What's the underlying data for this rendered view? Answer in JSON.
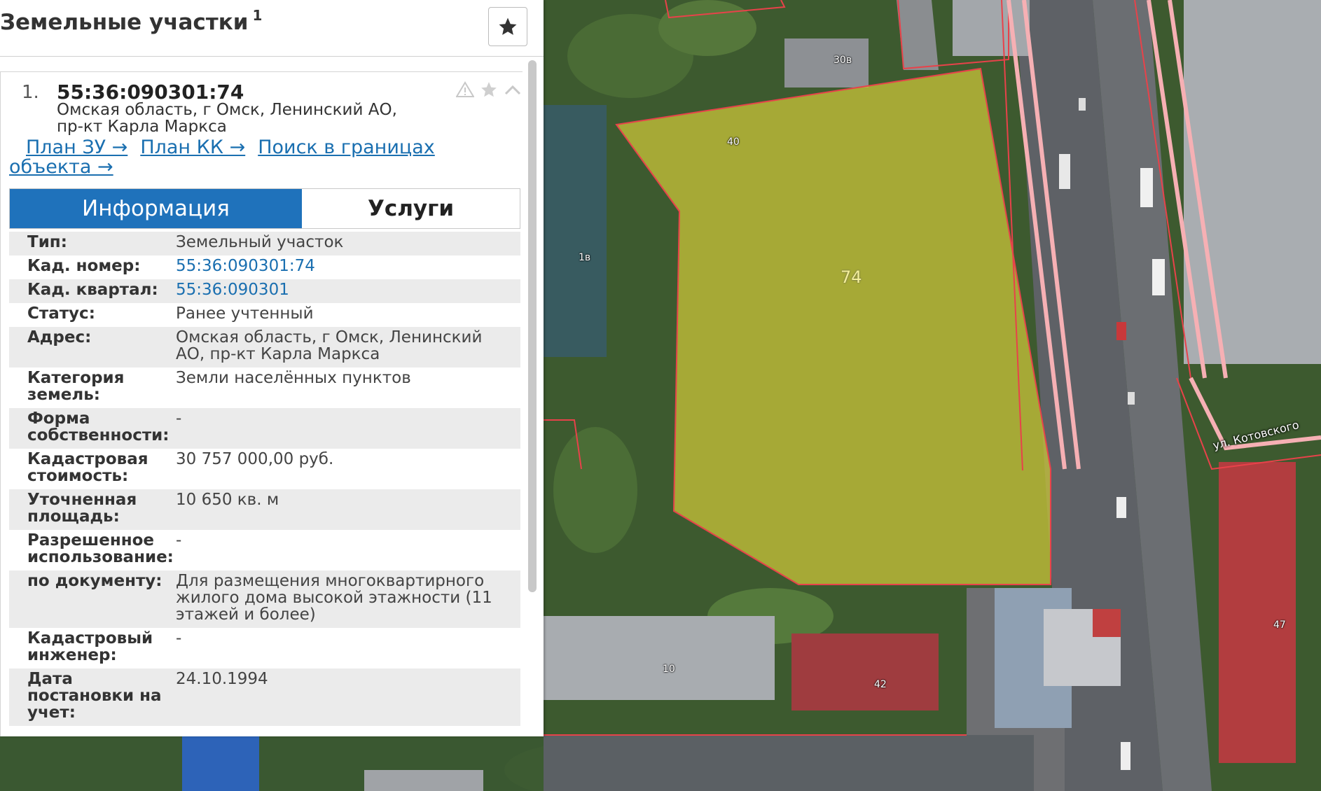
{
  "panel": {
    "title": "Земельные участки",
    "count": "1"
  },
  "card": {
    "index": "1.",
    "cad_number": "55:36:090301:74",
    "address": "Омская область, г Омск, Ленинский АО, пр-кт Карла Маркса",
    "icons": [
      "warning-icon",
      "star-icon",
      "chevron-up-icon"
    ],
    "links": {
      "plan_zu": "План ЗУ →",
      "plan_kk": "План КК →",
      "search": "Поиск в границах объекта →"
    },
    "tabs": {
      "info": "Информация",
      "services": "Услуги"
    },
    "rows": [
      {
        "label": "Тип:",
        "value": "Земельный участок"
      },
      {
        "label": "Кад. номер:",
        "value": "55:36:090301:74",
        "link": true
      },
      {
        "label": "Кад. квартал:",
        "value": "55:36:090301",
        "link": true
      },
      {
        "label": "Статус:",
        "value": "Ранее учтенный"
      },
      {
        "label": "Адрес:",
        "value": "Омская область, г Омск, Ленинский АО, пр-кт Карла Маркса"
      },
      {
        "label": "Категория земель:",
        "value": "Земли населённых пунктов"
      },
      {
        "label": "Форма собственности:",
        "value": "-"
      },
      {
        "label": "Кадастровая стоимость:",
        "value": "30 757 000,00 руб."
      },
      {
        "label": "Уточненная площадь:",
        "value": "10 650 кв. м"
      },
      {
        "label": "Разрешенное использование:",
        "value": "-"
      },
      {
        "label": "по документу:",
        "value": "Для размещения многоквартирного жилого дома высокой этажности (11 этажей и более)"
      },
      {
        "label": "Кадастровый инженер:",
        "value": "-"
      },
      {
        "label": "Дата постановки на учет:",
        "value": "24.10.1994"
      }
    ]
  },
  "map": {
    "parcel_label": "74",
    "street_label": "ул. Котовского",
    "building_labels": [
      "30в",
      "40",
      "1в",
      "10",
      "42",
      "47"
    ],
    "parcel_color": "#c9c43a",
    "boundary_color": "#e8424a"
  }
}
